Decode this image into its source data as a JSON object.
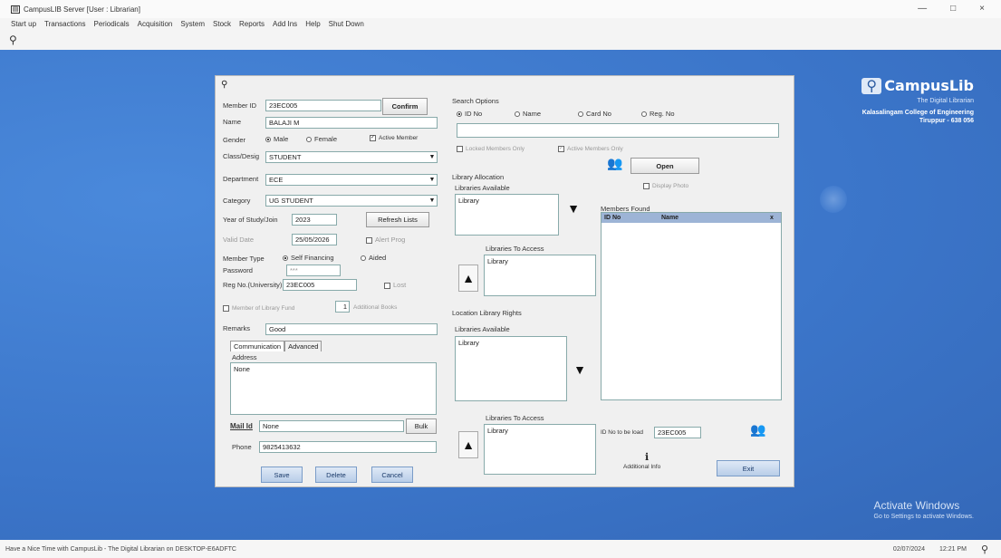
{
  "window": {
    "title": "CampusLIB Server [User : Librarian]",
    "controls": {
      "minimize": "—",
      "restore": "□",
      "close": "×"
    }
  },
  "menu": [
    "Start up",
    "Transactions",
    "Periodicals",
    "Acquisition",
    "System",
    "Stock",
    "Reports",
    "Add Ins",
    "Help",
    "Shut Down"
  ],
  "brand": {
    "logo": "CampusLib",
    "tagline": "The Digital Librarian",
    "college": "Kalasalingam College of Engineering",
    "place": "Tiruppur - 638 056"
  },
  "activate": {
    "title": "Activate Windows",
    "subtitle": "Go to Settings to activate Windows."
  },
  "status": {
    "text": "Have a Nice Time with CampusLib - The Digital Librarian on DESKTOP-E6ADFTC",
    "date": "02/07/2024",
    "time": "12:21 PM"
  },
  "form": {
    "member_id_label": "Member ID",
    "member_id": "23EC005",
    "confirm": "Confirm",
    "name_label": "Name",
    "name": "BALAJI M",
    "gender_label": "Gender",
    "gender_male": "Male",
    "gender_female": "Female",
    "active_member": "Active Member",
    "class_label": "Class/Desig",
    "class": "STUDENT",
    "department_label": "Department",
    "department": "ECE",
    "category_label": "Category",
    "category": "UG STUDENT",
    "year_label": "Year of Study/Join",
    "year": "2023",
    "refresh_lists": "Refresh Lists",
    "valid_label": "Valid Date",
    "valid": "25/05/2026",
    "alert_prog": "Alert Prog",
    "member_type_label": "Member Type",
    "self_financing": "Self Financing",
    "aided": "Aided",
    "password_label": "Password",
    "password": "***",
    "reg_label": "Reg No.(University)",
    "reg": "23EC005",
    "lost": "Lost",
    "member_library_label": "Member of Library Fund",
    "additional_books_count": "1",
    "additional_books": "Additional Books",
    "remarks_label": "Remarks",
    "remarks": "Good",
    "tab_communication": "Communication",
    "tab_advanced": "Advanced",
    "address_label": "Address",
    "address": "None",
    "mail_label": "Mail Id",
    "mail": "None",
    "bulk": "Bulk",
    "phone_label": "Phone",
    "phone": "9825413632",
    "save": "Save",
    "delete": "Delete",
    "cancel": "Cancel"
  },
  "search": {
    "title": "Search Options",
    "opt_id": "ID No",
    "opt_name": "Name",
    "opt_card": "Card No",
    "opt_reg": "Reg. No",
    "locked_only": "Locked Members Only",
    "active_only": "Active Members Only",
    "open": "Open",
    "display_photo": "Display Photo",
    "members_found": "Members Found",
    "col_id": "ID No",
    "col_name": "Name",
    "col_x": "x",
    "loaded_label": "ID No to be load",
    "loaded_value": "23EC005",
    "additional_info": "Additional Info",
    "exit": "Exit"
  },
  "library": {
    "allocation_title": "Library Allocation",
    "available_label": "Libraries Available",
    "available_item": "Library",
    "to_access_label": "Libraries To Access",
    "to_access_item": "Library",
    "location_title": "Location Library Rights",
    "loc_available_label": "Libraries Available",
    "loc_available_item": "Library",
    "loc_to_access_label": "Libraries To Access",
    "loc_to_access_item": "Library"
  }
}
